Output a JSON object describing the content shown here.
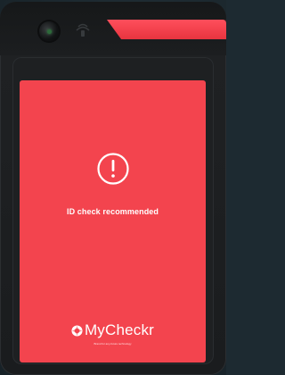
{
  "device": {
    "led_color": "#ff4f5c",
    "screen_color": "#f3444e"
  },
  "screen": {
    "icon": "alert-circle-icon",
    "status_text": "ID check recommended",
    "brand_name": "MyCheckr",
    "brand_tagline": "Brand for any-future technology"
  }
}
